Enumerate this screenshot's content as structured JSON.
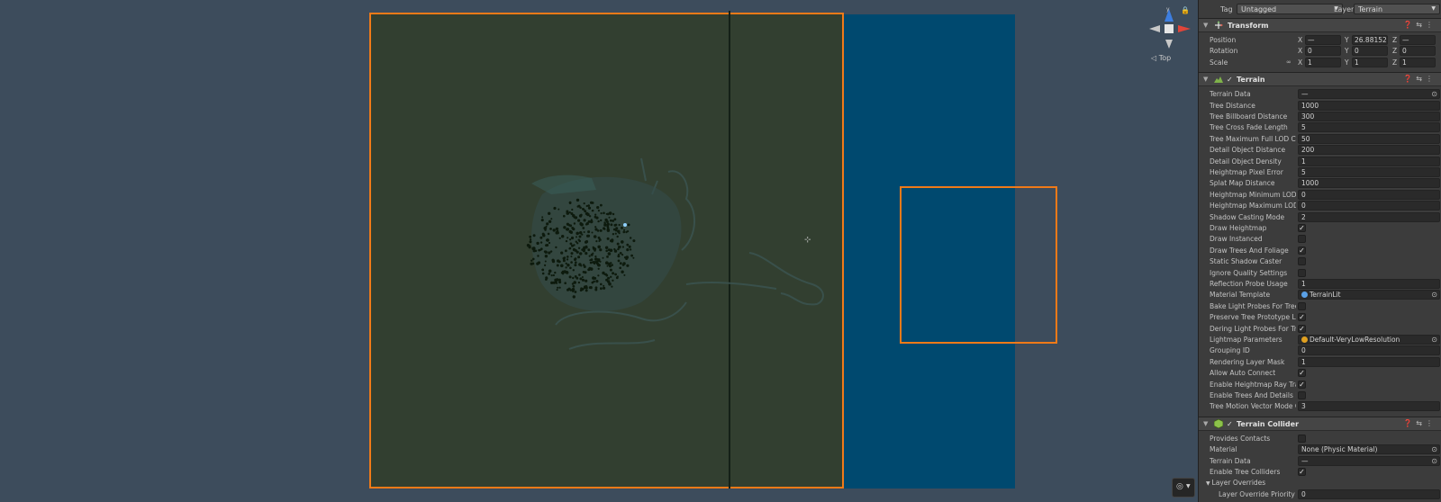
{
  "scene": {
    "gizmo_label": "◁ Top",
    "colors": {
      "terrain": "#323f30",
      "water": "#00496f",
      "selection": "#f07a18",
      "background": "#3d4c5c"
    }
  },
  "inspector": {
    "tag_label": "Tag",
    "tag_value": "Untagged",
    "layer_label": "Layer",
    "layer_value": "Terrain",
    "transform": {
      "title": "Transform",
      "rows": [
        {
          "label": "Position",
          "x": "—",
          "y": "26.88152",
          "z": "—"
        },
        {
          "label": "Rotation",
          "x": "0",
          "y": "0",
          "z": "0"
        },
        {
          "label": "Scale",
          "x": "1",
          "y": "1",
          "z": "1"
        }
      ]
    },
    "terrain": {
      "title": "Terrain",
      "rows": [
        {
          "label": "Terrain Data",
          "value": "—",
          "type": "object"
        },
        {
          "label": "Tree Distance",
          "value": "1000",
          "type": "text"
        },
        {
          "label": "Tree Billboard Distance",
          "value": "300",
          "type": "text"
        },
        {
          "label": "Tree Cross Fade Length",
          "value": "5",
          "type": "text"
        },
        {
          "label": "Tree Maximum Full LOD Co",
          "value": "50",
          "type": "text"
        },
        {
          "label": "Detail Object Distance",
          "value": "200",
          "type": "text"
        },
        {
          "label": "Detail Object Density",
          "value": "1",
          "type": "text"
        },
        {
          "label": "Heightmap Pixel Error",
          "value": "5",
          "type": "text"
        },
        {
          "label": "Splat Map Distance",
          "value": "1000",
          "type": "text"
        },
        {
          "label": "Heightmap Minimum LOD S",
          "value": "0",
          "type": "text"
        },
        {
          "label": "Heightmap Maximum LOD",
          "value": "0",
          "type": "text"
        },
        {
          "label": "Shadow Casting Mode",
          "value": "2",
          "type": "text"
        },
        {
          "label": "Draw Heightmap",
          "value": "✓",
          "type": "toggle"
        },
        {
          "label": "Draw Instanced",
          "value": "",
          "type": "toggle"
        },
        {
          "label": "Draw Trees And Foliage",
          "value": "✓",
          "type": "toggle"
        },
        {
          "label": "Static Shadow Caster",
          "value": "",
          "type": "toggle"
        },
        {
          "label": "Ignore Quality Settings",
          "value": "",
          "type": "toggle"
        },
        {
          "label": "Reflection Probe Usage",
          "value": "1",
          "type": "text"
        },
        {
          "label": "Material Template",
          "value": "TerrainLit",
          "type": "object",
          "icon_color": "#5aa0e6"
        },
        {
          "label": "Bake Light Probes For Tree",
          "value": "",
          "type": "toggle"
        },
        {
          "label": "Preserve Tree Prototype La",
          "value": "✓",
          "type": "toggle"
        },
        {
          "label": "Dering Light Probes For Tre",
          "value": "✓",
          "type": "toggle"
        },
        {
          "label": "Lightmap Parameters",
          "value": "Default-VeryLowResolution",
          "type": "object",
          "icon_color": "#e0a020"
        },
        {
          "label": "Grouping ID",
          "value": "0",
          "type": "text"
        },
        {
          "label": "Rendering Layer Mask",
          "value": "1",
          "type": "text"
        },
        {
          "label": "Allow Auto Connect",
          "value": "✓",
          "type": "toggle"
        },
        {
          "label": "Enable Heightmap Ray Trac",
          "value": "✓",
          "type": "toggle"
        },
        {
          "label": "Enable Trees And Details R",
          "value": "",
          "type": "toggle"
        },
        {
          "label": "Tree Motion Vector Mode C",
          "value": "3",
          "type": "text"
        }
      ]
    },
    "terrain_collider": {
      "title": "Terrain Collider",
      "rows": [
        {
          "label": "Provides Contacts",
          "value": "",
          "type": "toggle"
        },
        {
          "label": "Material",
          "value": "None (Physic Material)",
          "type": "object"
        },
        {
          "label": "Terrain Data",
          "value": "—",
          "type": "object"
        },
        {
          "label": "Enable Tree Colliders",
          "value": "✓",
          "type": "toggle"
        },
        {
          "label": "Layer Overrides",
          "value": "",
          "type": "foldout"
        },
        {
          "label": "Layer Override Priority",
          "value": "0",
          "type": "text",
          "indent": true
        }
      ]
    }
  }
}
